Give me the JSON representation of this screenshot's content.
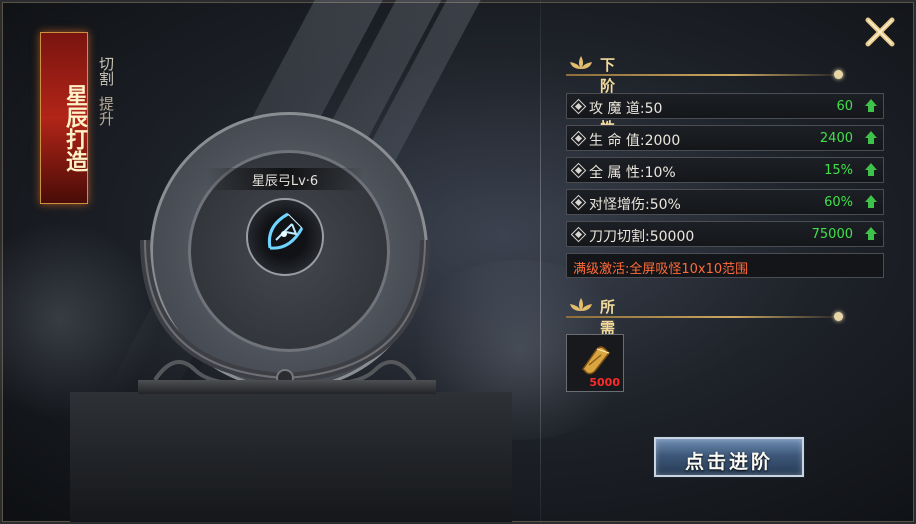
{
  "banner": {
    "title": "星辰打造"
  },
  "tabs": [
    {
      "label": "切割",
      "active": true
    },
    {
      "label": "提升",
      "active": false
    }
  ],
  "item": {
    "name": "星辰弓Lv·6",
    "icon": "bow-icon"
  },
  "next_tier": {
    "header": "下阶属性",
    "attributes": [
      {
        "name": "攻 魔 道:50",
        "next": "60"
      },
      {
        "name": "生 命 值:2000",
        "next": "2400"
      },
      {
        "name": "全 属 性:10%",
        "next": "15%"
      },
      {
        "name": "对怪增伤:50%",
        "next": "60%"
      },
      {
        "name": "刀刀切割:50000",
        "next": "75000"
      }
    ],
    "full_activation": "满级激活:全屏吸怪10x10范围"
  },
  "cost": {
    "header": "所需消耗",
    "items": [
      {
        "icon": "scroll-icon",
        "amount": "5000"
      }
    ]
  },
  "actions": {
    "advance_label": "点击进阶"
  },
  "colors": {
    "gain": "#3fe04a",
    "warning": "#ff6b3a",
    "gold": "#f0d99a",
    "cost": "#ff2a2a"
  }
}
